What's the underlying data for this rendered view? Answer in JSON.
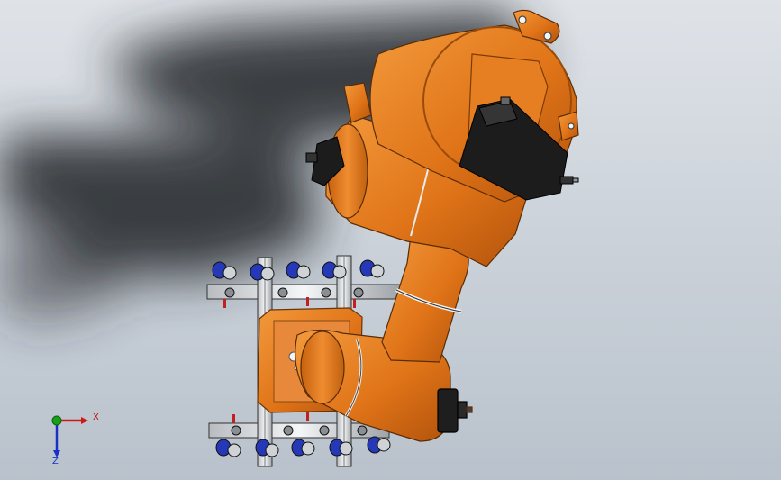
{
  "triad": {
    "x_label": "X",
    "z_label": "Z",
    "colors": {
      "x": "#d01818",
      "y": "#18a018",
      "z": "#1830c8"
    }
  },
  "model": {
    "description_icon": "robot-arm-assembly",
    "colors": {
      "body": "#e07820",
      "body_dark": "#b85a10",
      "motor": "#1c1c1c",
      "frame": "#d8dcdf",
      "roller": "#2030b0"
    }
  }
}
